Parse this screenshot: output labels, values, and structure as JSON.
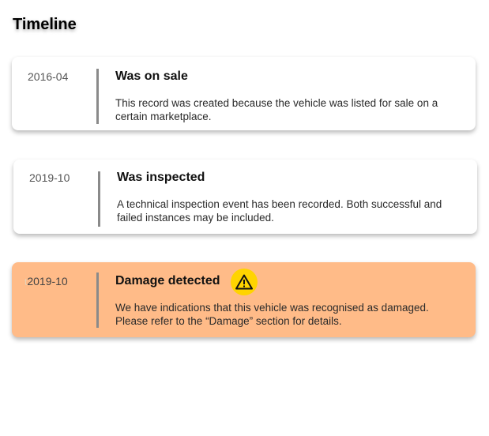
{
  "page": {
    "title": "Timeline"
  },
  "timeline": [
    {
      "date": "2016-04",
      "heading": "Was on sale",
      "description": "This record was created because the vehicle was listed for sale on a certain marketplace."
    },
    {
      "date": "2019-10",
      "heading": "Was inspected",
      "description": "A technical inspection event has been recorded. Both successful and failed instances may be included."
    },
    {
      "date": "2019-10",
      "date_prefix": "t",
      "heading": "Damage detected",
      "description": "We have indications that this vehicle was recognised as damaged. Please refer to the “Damage” section for details.",
      "icon": "warning-icon"
    }
  ],
  "colors": {
    "warning_card": "#ffbb88",
    "warning_icon_bg": "#ffd400",
    "divider": "#8a8a8a"
  }
}
